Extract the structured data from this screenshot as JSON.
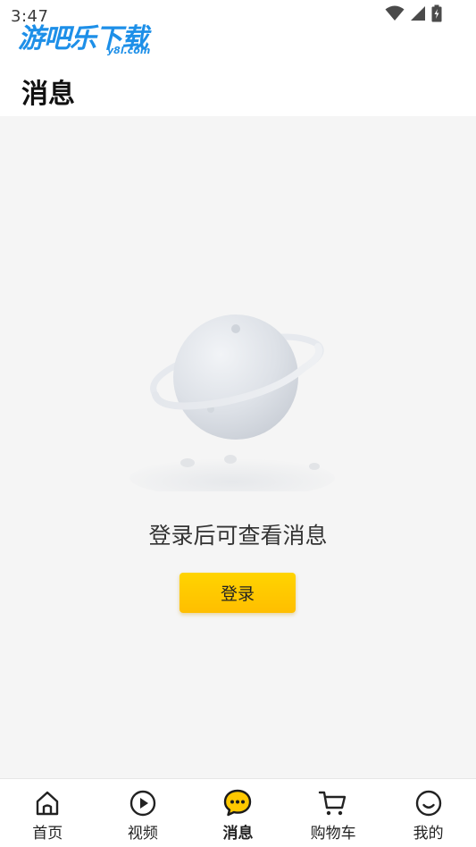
{
  "status_bar": {
    "time": "3:47",
    "icons": [
      "wifi-icon",
      "cell-signal-icon",
      "battery-charging-icon"
    ]
  },
  "watermark": {
    "main": "游吧乐下载",
    "sub": "y8l.com"
  },
  "header": {
    "title": "消息"
  },
  "empty_state": {
    "illustration": "planet-illustration",
    "message": "登录后可查看消息",
    "login_label": "登录"
  },
  "bottom_nav": {
    "active_index": 2,
    "items": [
      {
        "label": "首页",
        "icon": "home-icon"
      },
      {
        "label": "视频",
        "icon": "play-circle-icon"
      },
      {
        "label": "消息",
        "icon": "message-bubble-icon"
      },
      {
        "label": "购物车",
        "icon": "shopping-cart-icon"
      },
      {
        "label": "我的",
        "icon": "smiley-face-icon"
      }
    ]
  },
  "colors": {
    "accent_yellow": "#ffc800",
    "background_gray": "#f5f5f5",
    "watermark_blue": "#1d8fe8"
  }
}
